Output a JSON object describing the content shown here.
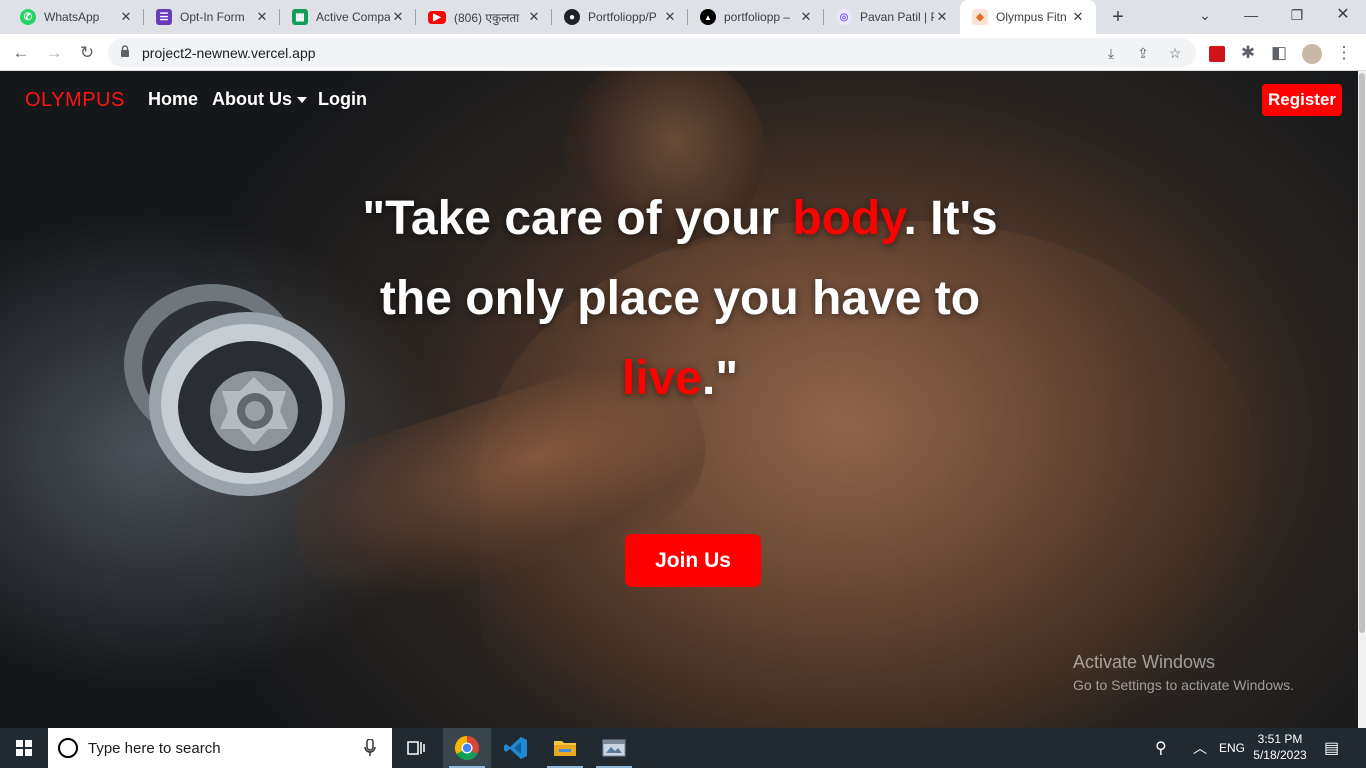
{
  "browser": {
    "tabs": [
      {
        "title": "WhatsApp",
        "icon": "whatsapp-icon",
        "color": "#25d366"
      },
      {
        "title": "Opt-In Form",
        "icon": "forms-icon",
        "color": "#673ab7"
      },
      {
        "title": "Active Compa",
        "icon": "sheets-icon",
        "color": "#0f9d58"
      },
      {
        "title": "(806) एकुलता",
        "icon": "youtube-icon",
        "color": "#ff0000"
      },
      {
        "title": "Portfoliopp/P",
        "icon": "github-icon",
        "color": "#1f2328"
      },
      {
        "title": "portfoliopp –",
        "icon": "vercel-icon",
        "color": "#000000"
      },
      {
        "title": "Pavan Patil | P",
        "icon": "profile-icon",
        "color": "#7c5cff"
      },
      {
        "title": "Olympus Fitn",
        "icon": "olympus-icon",
        "color": "#e5692b"
      }
    ],
    "url": "project2-newnew.vercel.app"
  },
  "page": {
    "brand": "OLYMPUS",
    "nav": {
      "home": "Home",
      "about": "About Us",
      "login": "Login",
      "register": "Register"
    },
    "quote": {
      "p1": "\"Take care of your ",
      "h1": "body",
      "p2": ". It's the only place you have to ",
      "h2": "live",
      "p3": ".\""
    },
    "cta": "Join Us",
    "accent_color": "#ff0000"
  },
  "watermark": {
    "line1": "Activate Windows",
    "line2": "Go to Settings to activate Windows."
  },
  "taskbar": {
    "search_placeholder": "Type here to search",
    "language": "ENG",
    "time": "3:51 PM",
    "date": "5/18/2023"
  }
}
